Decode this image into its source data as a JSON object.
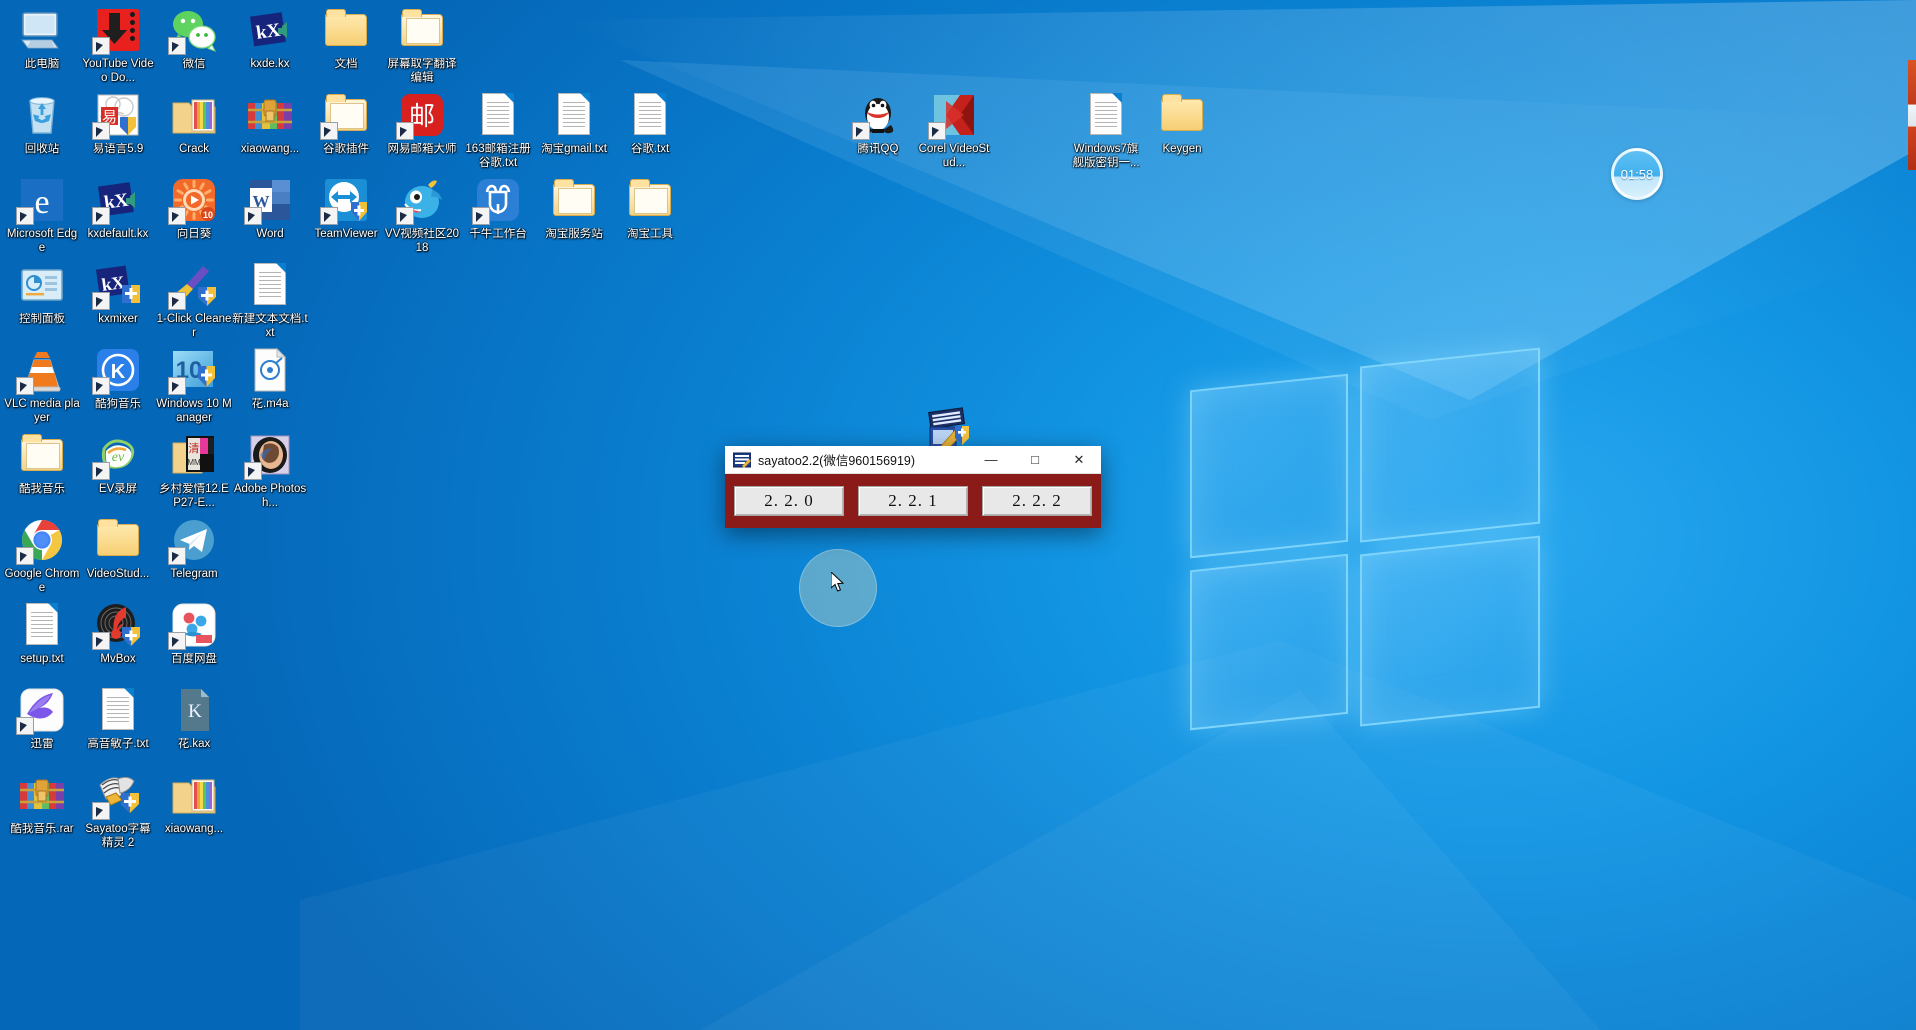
{
  "desktop": {
    "wallpaper": "windows-10-hero-blue",
    "background_color": "#0b8ee0"
  },
  "clock_widget": {
    "name": "desktop-clock-gadget",
    "time": "01:58"
  },
  "icons": [
    {
      "label": "此电脑",
      "kind": "computer",
      "shortcut": false,
      "col": 0,
      "row": 0
    },
    {
      "label": "YouTube Video Do...",
      "kind": "youtube-downloader",
      "shortcut": true,
      "col": 1,
      "row": 0
    },
    {
      "label": "微信",
      "kind": "wechat",
      "shortcut": true,
      "col": 2,
      "row": 0
    },
    {
      "label": "kxde.kx",
      "kind": "kx-file",
      "shortcut": false,
      "col": 3,
      "row": 0
    },
    {
      "label": "文档",
      "kind": "folder",
      "shortcut": false,
      "col": 4,
      "row": 0
    },
    {
      "label": "屏幕取字翻译编辑",
      "kind": "folder-open",
      "shortcut": false,
      "col": 5,
      "row": 0
    },
    {
      "label": "回收站",
      "kind": "recycle-bin",
      "shortcut": false,
      "col": 0,
      "row": 1
    },
    {
      "label": "易语言5.9",
      "kind": "eyuyan",
      "shortcut": true,
      "col": 1,
      "row": 1
    },
    {
      "label": "Crack",
      "kind": "folder-color",
      "shortcut": false,
      "col": 2,
      "row": 1
    },
    {
      "label": "xiaowang...",
      "kind": "winrar",
      "shortcut": false,
      "col": 3,
      "row": 1
    },
    {
      "label": "谷歌插件",
      "kind": "folder-open",
      "shortcut": true,
      "col": 4,
      "row": 1
    },
    {
      "label": "网易邮箱大师",
      "kind": "netease-mail",
      "shortcut": true,
      "col": 5,
      "row": 1
    },
    {
      "label": "163邮箱注册谷歌.txt",
      "kind": "text-file",
      "shortcut": false,
      "col": 6,
      "row": 1
    },
    {
      "label": "淘宝gmail.txt",
      "kind": "text-file",
      "shortcut": false,
      "col": 7,
      "row": 1
    },
    {
      "label": "谷歌.txt",
      "kind": "text-file",
      "shortcut": false,
      "col": 8,
      "row": 1
    },
    {
      "label": "Microsoft Edge",
      "kind": "edge",
      "shortcut": true,
      "col": 0,
      "row": 2
    },
    {
      "label": "kxdefault.kx",
      "kind": "kx-file",
      "shortcut": true,
      "col": 1,
      "row": 2
    },
    {
      "label": "向日葵",
      "kind": "sunlogin",
      "shortcut": true,
      "col": 2,
      "row": 2
    },
    {
      "label": "Word",
      "kind": "word",
      "shortcut": true,
      "col": 3,
      "row": 2
    },
    {
      "label": "TeamViewer",
      "kind": "teamviewer",
      "shortcut": true,
      "col": 4,
      "row": 2
    },
    {
      "label": "VV视频社区2018",
      "kind": "vv-video",
      "shortcut": true,
      "col": 5,
      "row": 2
    },
    {
      "label": "千牛工作台",
      "kind": "qianniu",
      "shortcut": true,
      "col": 6,
      "row": 2
    },
    {
      "label": "淘宝服务站",
      "kind": "folder-open",
      "shortcut": false,
      "col": 7,
      "row": 2
    },
    {
      "label": "淘宝工具",
      "kind": "folder-open",
      "shortcut": false,
      "col": 8,
      "row": 2
    },
    {
      "label": "控制面板",
      "kind": "control-panel",
      "shortcut": false,
      "col": 0,
      "row": 3
    },
    {
      "label": "kxmixer",
      "kind": "kx-mixer",
      "shortcut": true,
      "col": 1,
      "row": 3
    },
    {
      "label": "1-Click Cleaner",
      "kind": "cleaner",
      "shortcut": true,
      "col": 2,
      "row": 3
    },
    {
      "label": "新建文本文档.txt",
      "kind": "text-file",
      "shortcut": false,
      "col": 3,
      "row": 3
    },
    {
      "label": "VLC media player",
      "kind": "vlc",
      "shortcut": true,
      "col": 0,
      "row": 4
    },
    {
      "label": "酷狗音乐",
      "kind": "kugou",
      "shortcut": true,
      "col": 1,
      "row": 4
    },
    {
      "label": "Windows 10 Manager",
      "kind": "win10-manager",
      "shortcut": true,
      "col": 2,
      "row": 4
    },
    {
      "label": "花.m4a",
      "kind": "audio-file",
      "shortcut": false,
      "col": 3,
      "row": 4
    },
    {
      "label": "酷我音乐",
      "kind": "folder-open",
      "shortcut": false,
      "col": 0,
      "row": 5
    },
    {
      "label": "EV录屏",
      "kind": "ev-capture",
      "shortcut": true,
      "col": 1,
      "row": 5
    },
    {
      "label": "乡村爱情12.EP27-E...",
      "kind": "video-folder",
      "shortcut": false,
      "col": 2,
      "row": 5
    },
    {
      "label": "Adobe Photosh...",
      "kind": "photoshop",
      "shortcut": true,
      "col": 3,
      "row": 5
    },
    {
      "label": "Google Chrome",
      "kind": "chrome",
      "shortcut": true,
      "col": 0,
      "row": 6
    },
    {
      "label": "VideoStud...",
      "kind": "folder",
      "shortcut": false,
      "col": 1,
      "row": 6
    },
    {
      "label": "Telegram",
      "kind": "telegram",
      "shortcut": true,
      "col": 2,
      "row": 6
    },
    {
      "label": "setup.txt",
      "kind": "text-file",
      "shortcut": false,
      "col": 0,
      "row": 7
    },
    {
      "label": "MvBox",
      "kind": "mvbox",
      "shortcut": true,
      "col": 1,
      "row": 7
    },
    {
      "label": "百度网盘",
      "kind": "baidu-netdisk",
      "shortcut": true,
      "col": 2,
      "row": 7
    },
    {
      "label": "迅雷",
      "kind": "thunder",
      "shortcut": true,
      "col": 0,
      "row": 8
    },
    {
      "label": "高音敏子.txt",
      "kind": "text-file",
      "shortcut": false,
      "col": 1,
      "row": 8
    },
    {
      "label": "花.kax",
      "kind": "kax-file",
      "shortcut": false,
      "col": 2,
      "row": 8
    },
    {
      "label": "酷我音乐.rar",
      "kind": "winrar",
      "shortcut": false,
      "col": 0,
      "row": 9
    },
    {
      "label": "Sayatoo字幕精灵 2",
      "kind": "sayatoo",
      "shortcut": true,
      "col": 1,
      "row": 9
    },
    {
      "label": "xiaowang...",
      "kind": "folder-color",
      "shortcut": false,
      "col": 2,
      "row": 9
    },
    {
      "label": "腾讯QQ",
      "kind": "qq",
      "shortcut": true,
      "col": 11,
      "row": 1
    },
    {
      "label": "Corel VideoStud...",
      "kind": "corel-videostudio",
      "shortcut": true,
      "col": 12,
      "row": 1
    },
    {
      "label": "Windows7旗舰版密钥一...",
      "kind": "text-file",
      "shortcut": false,
      "col": 14,
      "row": 1
    },
    {
      "label": "Keygen",
      "kind": "folder",
      "shortcut": false,
      "col": 15,
      "row": 1
    }
  ],
  "dialog": {
    "title": "sayatoo2.2(微信960156919)",
    "icon_name": "sayatoo-app-icon",
    "body_color": "#8b1b18",
    "minimize_glyph": "—",
    "maximize_glyph": "□",
    "close_glyph": "✕",
    "buttons": [
      {
        "label": "2. 2. 0"
      },
      {
        "label": "2. 2. 1"
      },
      {
        "label": "2. 2. 2"
      }
    ]
  }
}
